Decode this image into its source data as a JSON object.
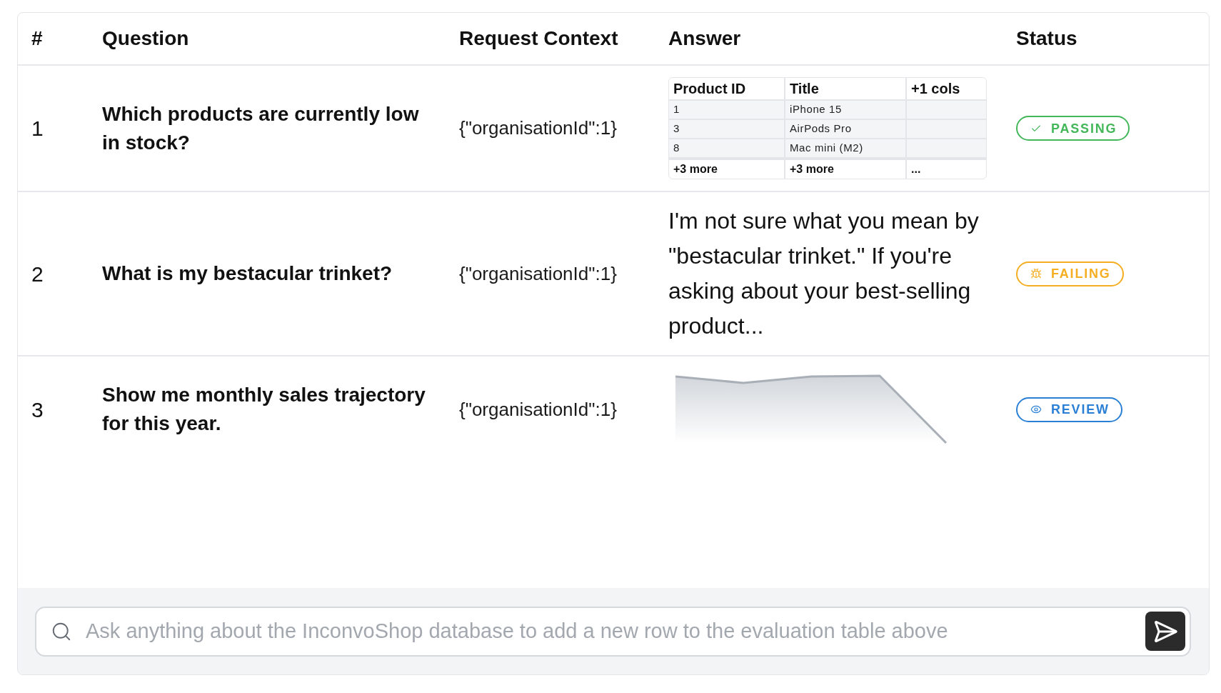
{
  "table": {
    "columns": [
      "#",
      "Question",
      "Request Context",
      "Answer",
      "Status"
    ],
    "rows": [
      {
        "number": "1",
        "question": "Which products are currently low in stock?",
        "request_context": "{\"organisationId\":1}",
        "answer": {
          "kind": "table",
          "columns": [
            "Product ID",
            "Title",
            "+1 cols"
          ],
          "rows": [
            [
              "1",
              "iPhone 15"
            ],
            [
              "3",
              "AirPods Pro"
            ],
            [
              "8",
              "Mac mini (M2)"
            ]
          ],
          "footer": [
            "+3 more",
            "+3 more",
            "..."
          ]
        },
        "status": {
          "kind": "passing",
          "label": "PASSING",
          "color": "#43b75a"
        }
      },
      {
        "number": "2",
        "question": "What is my bestacular trinket?",
        "request_context": "{\"organisationId\":1}",
        "answer": {
          "kind": "text",
          "text": "I'm not sure what you mean by \"bestacular trinket.\" If you're asking about your best-selling product..."
        },
        "status": {
          "kind": "failing",
          "label": "FAILING",
          "color": "#f5ae22"
        }
      },
      {
        "number": "3",
        "question": "Show me monthly sales trajectory for this year.",
        "request_context": "{\"organisationId\":1}",
        "answer": {
          "kind": "chart"
        },
        "status": {
          "kind": "review",
          "label": "REVIEW",
          "color": "#2b80d6"
        }
      }
    ]
  },
  "chat_input": {
    "placeholder": "Ask anything about the InconvoShop database to add a new row to the evaluation table above"
  }
}
